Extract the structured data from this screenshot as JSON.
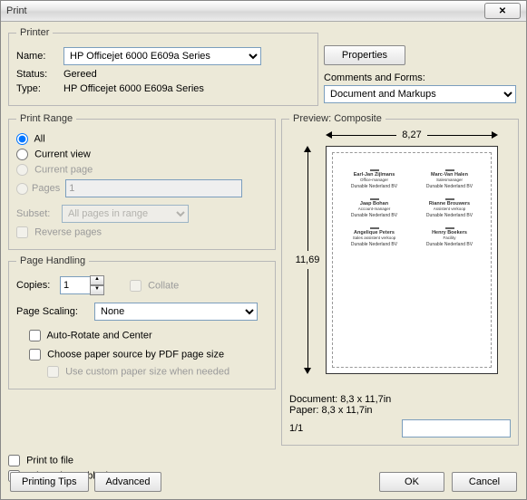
{
  "title": "Print",
  "printer": {
    "legend": "Printer",
    "name_label": "Name:",
    "name_value": "HP Officejet 6000 E609a Series",
    "properties_btn": "Properties",
    "status_label": "Status:",
    "status_value": "Gereed",
    "type_label": "Type:",
    "type_value": "HP Officejet 6000 E609a Series"
  },
  "comments": {
    "label": "Comments and Forms:",
    "value": "Document and Markups"
  },
  "print_range": {
    "legend": "Print Range",
    "all": "All",
    "current_view": "Current view",
    "current_page": "Current page",
    "pages": "Pages",
    "pages_value": "1",
    "subset_label": "Subset:",
    "subset_value": "All pages in range",
    "reverse": "Reverse pages"
  },
  "page_handling": {
    "legend": "Page Handling",
    "copies_label": "Copies:",
    "copies_value": "1",
    "collate": "Collate",
    "scaling_label": "Page Scaling:",
    "scaling_value": "None",
    "autorotate": "Auto-Rotate and Center",
    "choose_paper": "Choose paper source by PDF page size",
    "custom_paper": "Use custom paper size when needed"
  },
  "preview": {
    "legend": "Preview: Composite",
    "width": "8,27",
    "height": "11,69",
    "doc_label": "Document: 8,3 x 11,7in",
    "paper_label": "Paper: 8,3 x 11,7in",
    "page_indicator": "1/1"
  },
  "print_to_file": "Print to file",
  "print_color_black": "Print color as black",
  "printing_tips_btn": "Printing Tips",
  "advanced_btn": "Advanced",
  "ok_btn": "OK",
  "cancel_btn": "Cancel",
  "cards": [
    {
      "name": "Earl-Jan Zijlmans",
      "role": "Office-manager",
      "org": "Dunable Nederland BV"
    },
    {
      "name": "Marc-Van Halen",
      "role": "Salesmanager",
      "org": "Dunable Nederland BV"
    },
    {
      "name": "Jaap Bohan",
      "role": "Account-manager",
      "org": "Dunable Nederland BV"
    },
    {
      "name": "Rianne Brouwers",
      "role": "Assistent verkoop",
      "org": "Dunable Nederland BV"
    },
    {
      "name": "Angelique Peters",
      "role": "Sales assistent verkoop",
      "org": "Dunable Nederland BV"
    },
    {
      "name": "Henry Boekers",
      "role": "Facility",
      "org": "Dunable Nederland BV"
    }
  ]
}
